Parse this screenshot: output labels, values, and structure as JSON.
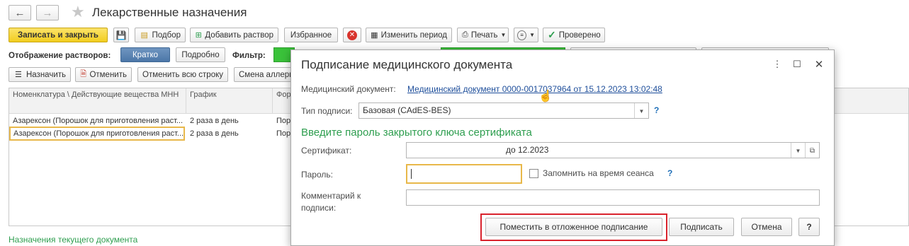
{
  "window": {
    "title": "Лекарственные назначения"
  },
  "toolbar1": {
    "save_close": "Записать и закрыть",
    "podbor": "Подбор",
    "add_solution": "Добавить раствор",
    "favorites": "Избранное",
    "change_period": "Изменить период",
    "print": "Печать",
    "checked": "Проверено"
  },
  "toolbar2": {
    "display_label": "Отображение растворов:",
    "brief": "Кратко",
    "detailed": "Подробно",
    "filter_label": "Фильтр:"
  },
  "toolbar3": {
    "assign": "Назначить",
    "cancel": "Отменить",
    "cancel_row": "Отменить всю строку",
    "change_allergy": "Смена аллерг"
  },
  "grid": {
    "headers": [
      "Номенклатура \\ Действующие вещества МНН",
      "График",
      "Фор выпу"
    ],
    "rows": [
      [
        "Азарексон (Порошок для приготовления раст...",
        "2 раза в день",
        "Пор"
      ],
      [
        "Азарексон (Порошок для приготовления раст...",
        "2 раза в день",
        "Пор"
      ]
    ]
  },
  "footer": {
    "status": "Назначения текущего документа"
  },
  "dialog": {
    "title": "Подписание медицинского документа",
    "doc_label": "Медицинский документ:",
    "doc_link": "Медицинский документ 0000-0017037964 от 15.12.2023 13:02:48",
    "sign_type_label": "Тип подписи:",
    "sign_type_value": "Базовая (CAdES-BES)",
    "section_heading": "Введите пароль закрытого ключа сертификата",
    "cert_label": "Сертификат:",
    "cert_value": "до 12.2023",
    "password_label": "Пароль:",
    "password_value": "",
    "remember_label": "Запомнить на время сеанса",
    "comment_label": "Комментарий к подписи:",
    "comment_value": "",
    "btn_deferred": "Поместить в отложенное подписание",
    "btn_sign": "Подписать",
    "btn_cancel": "Отмена",
    "btn_help": "?",
    "help_q": "?",
    "colors": {
      "accent_green": "#2e9e4f",
      "link": "#1f4f9b",
      "highlight": "#e8b84a",
      "red_frame": "#d9232d"
    }
  }
}
